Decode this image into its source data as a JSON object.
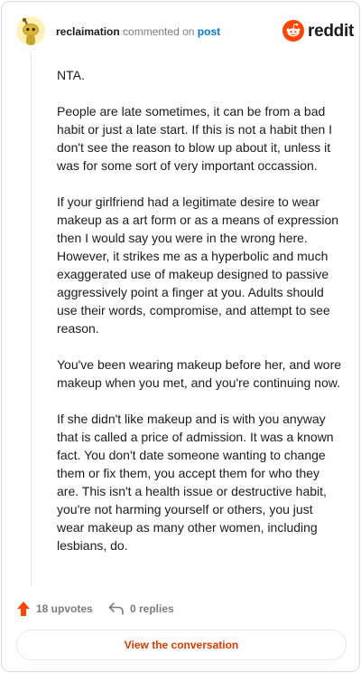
{
  "comment": {
    "username": "reclaimation",
    "action_text": "commented on",
    "post_link": "post",
    "paragraphs": [
      "NTA.",
      "People are late sometimes, it can be from a bad habit or just a late start. If this is not a habit then I don't see the reason to blow up about it, unless it was for some sort of very important occassion.",
      "If your girlfriend had a legitimate desire to wear makeup as a art form or as a means of expression then I would say you were in the wrong here. However, it strikes me as a hyperbolic and much exaggerated use of makeup designed to passive aggressively point a finger at you. Adults should use their words, compromise, and attempt to see reason.",
      "You've been wearing makeup before her, and wore makeup when you met, and you're continuing now.",
      "If she didn't like makeup and is with you anyway that is called a price of admission. It was a known fact. You don't date someone wanting to change them or fix them, you accept them for who they are. This isn't a health issue or destructive habit, you're not harming yourself or others, you just wear makeup as many other women, including lesbians, do."
    ]
  },
  "brand": {
    "name": "reddit",
    "color": "#ff4500"
  },
  "actions": {
    "upvotes_label": "18 upvotes",
    "replies_label": "0 replies",
    "upvote_color": "#ff4500"
  },
  "cta": {
    "label": "View the conversation",
    "color": "#d93a00"
  },
  "icons": {
    "avatar": "snoo-avatar-icon",
    "brand": "reddit-logo-icon",
    "upvote": "upvote-arrow-icon",
    "reply": "reply-arrow-icon"
  }
}
